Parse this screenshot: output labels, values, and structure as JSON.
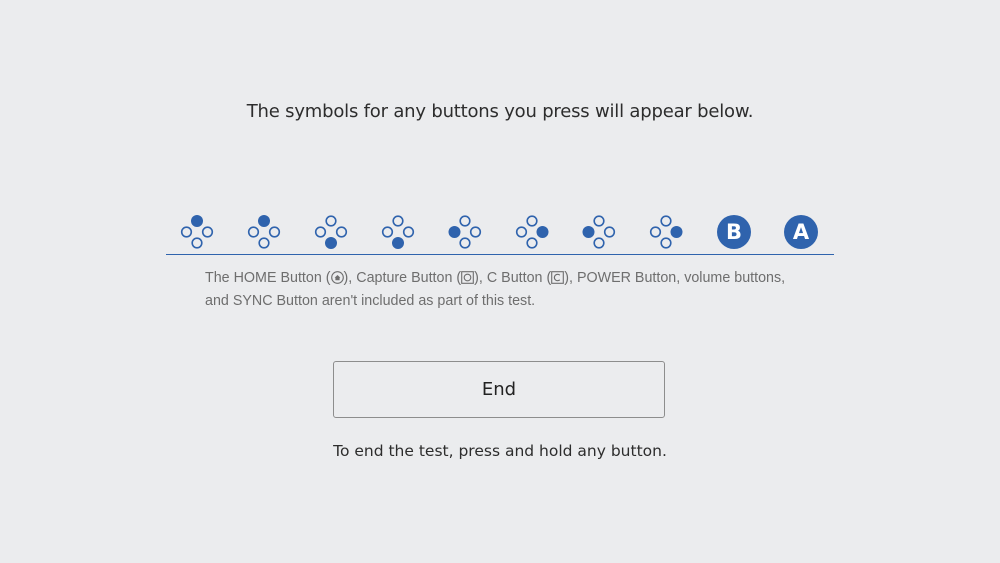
{
  "heading": "The symbols for any buttons you press will appear below.",
  "buttons": [
    {
      "name": "dpad-up-icon",
      "filled": "up"
    },
    {
      "name": "face-x-icon",
      "filled": "up"
    },
    {
      "name": "dpad-down-icon",
      "filled": "down"
    },
    {
      "name": "face-b-icon",
      "filled": "down"
    },
    {
      "name": "dpad-left-icon",
      "filled": "left"
    },
    {
      "name": "face-a-icon",
      "filled": "right"
    },
    {
      "name": "face-y-icon",
      "filled": "left"
    },
    {
      "name": "dpad-right-icon",
      "filled": "right"
    },
    {
      "name": "b-button-icon",
      "label": "B"
    },
    {
      "name": "a-button-icon",
      "label": "A"
    }
  ],
  "note": {
    "part1": "The HOME Button (",
    "part2": "), Capture Button (",
    "part3": "), C Button (",
    "part4": "), POWER Button, volume buttons,",
    "line2": "and SYNC Button aren't included as part of this test."
  },
  "end_button": "End",
  "footer": "To end the test, press and hold any button.",
  "colors": {
    "accent": "#2f63ad",
    "background": "#ebecee"
  }
}
